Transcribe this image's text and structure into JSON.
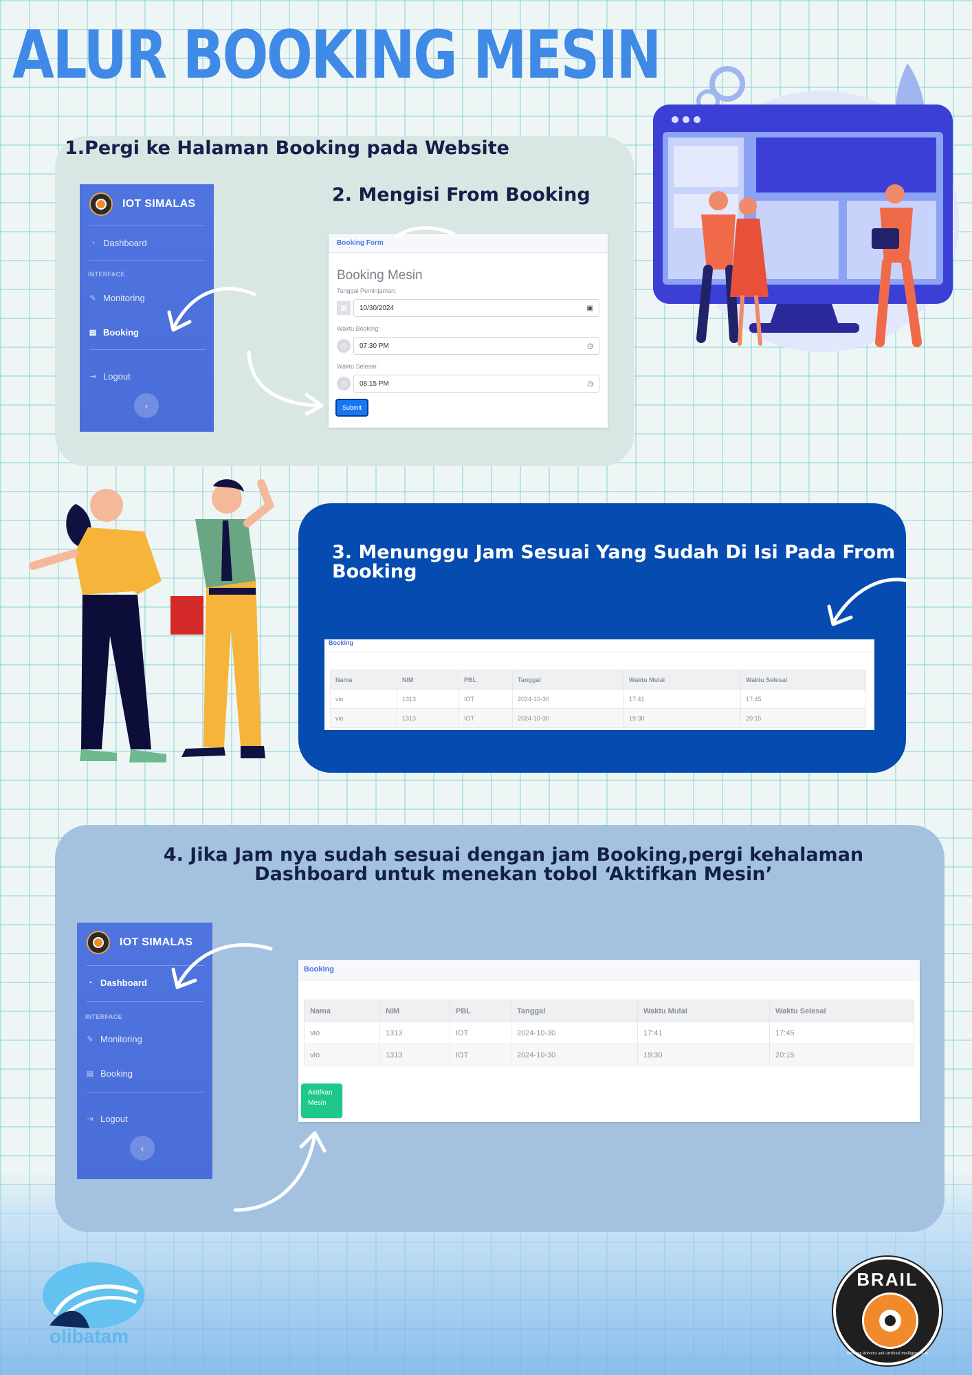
{
  "title": "ALUR BOOKING MESIN",
  "steps": {
    "s1": "1.Pergi ke Halaman Booking pada Website",
    "s2": "2. Mengisi From Booking",
    "s3_line1": "3. Menunggu Jam Sesuai Yang Sudah Di Isi Pada From",
    "s3_line2": "Booking",
    "s4_line1": "4. Jika Jam nya sudah sesuai dengan jam Booking,pergi kehalaman",
    "s4_line2": "Dashboard untuk menekan tobol ‘Aktifkan Mesin’"
  },
  "sidebar": {
    "brand": "IOT SIMALAS",
    "heading": "INTERFACE",
    "items": {
      "dashboard": "Dashboard",
      "monitoring": "Monitoring",
      "booking": "Booking",
      "logout": "Logout"
    },
    "toggle": "‹"
  },
  "form": {
    "header": "Booking Form",
    "title": "Booking Mesin",
    "date_label": "Tanggal Peminjaman:",
    "date_value": "10/30/2024",
    "start_label": "Waktu Booking:",
    "start_value": "07:30 PM",
    "end_label": "Waktu Selesai:",
    "end_value": "08:15 PM",
    "submit": "Submit"
  },
  "booking_table": {
    "header": "Booking",
    "columns": [
      "Nama",
      "NIM",
      "PBL",
      "Tanggal",
      "Waktu Mulai",
      "Waktu Selesai"
    ],
    "rows": [
      [
        "vio",
        "1313",
        "IOT",
        "2024-10-30",
        "17:41",
        "17:45"
      ],
      [
        "vio",
        "1313",
        "IOT",
        "2024-10-30",
        "19:30",
        "20:15"
      ]
    ]
  },
  "aktifkan": {
    "line1": "Aktifkan",
    "line2": "Mesin"
  },
  "logos": {
    "polibatam": "olibatam",
    "brail_name": "BRAIL",
    "brail_tagline": "Barelang Robotics and Artificial Intelligence Lab"
  },
  "colors": {
    "title": "#3f8ae6",
    "panel1": "#d8e7e4",
    "panel3": "#064cb0",
    "panel4": "#a4c2df",
    "sidebar": "#4e73df",
    "submit": "#1677f2",
    "aktifkan": "#1cc88a"
  }
}
